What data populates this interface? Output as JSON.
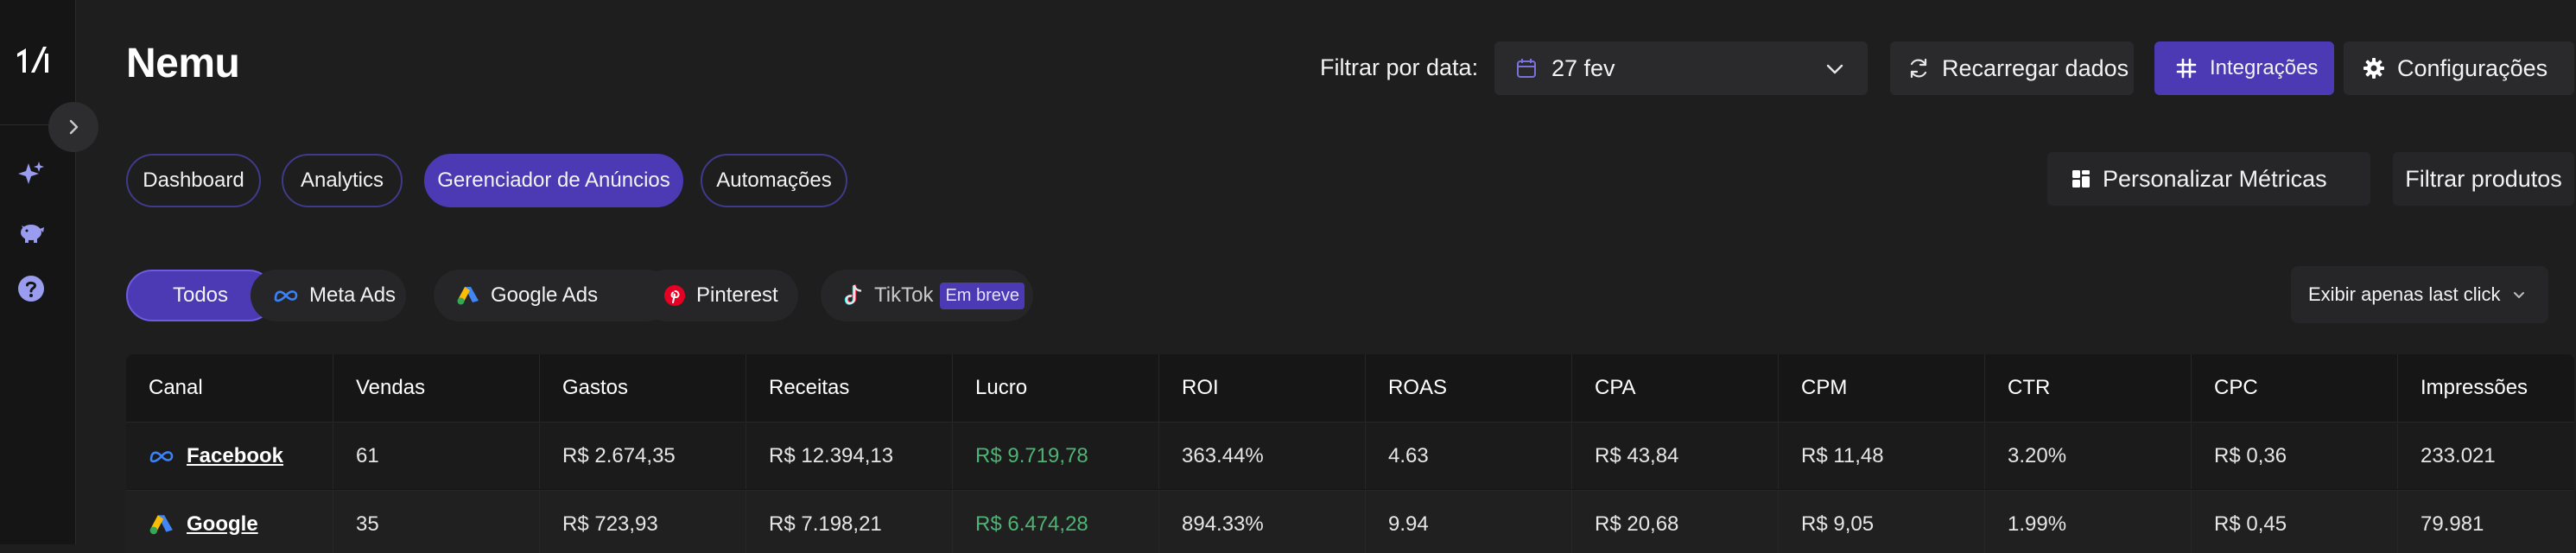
{
  "app": {
    "title": "Nemu"
  },
  "header": {
    "filter_label": "Filtrar por data:",
    "date_value": "27 fev",
    "reload_label": "Recarregar dados",
    "integrations_label": "Integrações",
    "settings_label": "Configurações"
  },
  "nav": {
    "tabs": [
      {
        "label": "Dashboard",
        "active": false
      },
      {
        "label": "Analytics",
        "active": false
      },
      {
        "label": "Gerenciador de Anúncios",
        "active": true
      },
      {
        "label": "Automações",
        "active": false
      }
    ],
    "customize_metrics_label": "Personalizar Métricas",
    "filter_products_label": "Filtrar produtos"
  },
  "channels": {
    "chips": [
      {
        "label": "Todos",
        "active": true,
        "icon": ""
      },
      {
        "label": "Meta Ads",
        "active": false,
        "icon": "meta-icon"
      },
      {
        "label": "Google Ads",
        "active": false,
        "icon": "google-ads-icon"
      },
      {
        "label": "Pinterest",
        "active": false,
        "icon": "pinterest-icon"
      },
      {
        "label": "TikTok",
        "active": false,
        "icon": "tiktok-icon",
        "badge": "Em breve"
      }
    ],
    "attribution_select": "Exibir apenas last click"
  },
  "table": {
    "columns": [
      "Canal",
      "Vendas",
      "Gastos",
      "Receitas",
      "Lucro",
      "ROI",
      "ROAS",
      "CPA",
      "CPM",
      "CTR",
      "CPC",
      "Impressões"
    ],
    "rows": [
      {
        "canal": "Facebook",
        "icon": "meta-icon",
        "vendas": "61",
        "gastos": "R$ 2.674,35",
        "receitas": "R$ 12.394,13",
        "lucro": "R$ 9.719,78",
        "roi": "363.44%",
        "roas": "4.63",
        "cpa": "R$ 43,84",
        "cpm": "R$ 11,48",
        "ctr": "3.20%",
        "cpc": "R$ 0,36",
        "impressoes": "233.021"
      },
      {
        "canal": "Google",
        "icon": "google-ads-icon",
        "vendas": "35",
        "gastos": "R$ 723,93",
        "receitas": "R$ 7.198,21",
        "lucro": "R$ 6.474,28",
        "roi": "894.33%",
        "roas": "9.94",
        "cpa": "R$ 20,68",
        "cpm": "R$ 9,05",
        "ctr": "1.99%",
        "cpc": "R$ 0,45",
        "impressoes": "79.981"
      }
    ]
  },
  "colors": {
    "accent": "#4b3ab3",
    "profit": "#4fb374",
    "background": "#1e1e1f"
  }
}
